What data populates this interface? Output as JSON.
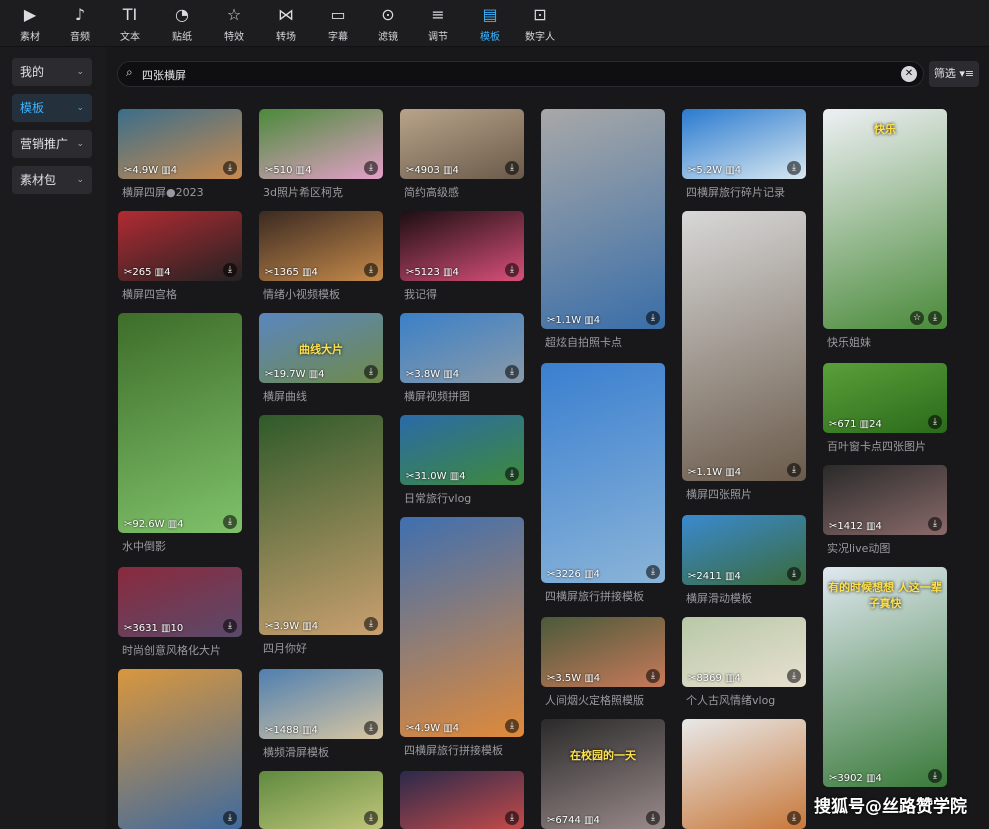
{
  "toolbar": {
    "items": [
      {
        "label": "素材",
        "icon": "media-icon"
      },
      {
        "label": "音频",
        "icon": "audio-icon"
      },
      {
        "label": "文本",
        "icon": "text-icon"
      },
      {
        "label": "贴纸",
        "icon": "sticker-icon"
      },
      {
        "label": "特效",
        "icon": "effects-icon"
      },
      {
        "label": "转场",
        "icon": "transition-icon"
      },
      {
        "label": "字幕",
        "icon": "subtitle-icon"
      },
      {
        "label": "滤镜",
        "icon": "filter-icon"
      },
      {
        "label": "调节",
        "icon": "adjust-icon"
      },
      {
        "label": "模板",
        "icon": "template-icon",
        "active": true
      },
      {
        "label": "数字人",
        "icon": "digital-human-icon"
      }
    ],
    "icons": [
      "▶",
      "♪",
      "TI",
      "◔",
      "☆",
      "⋈",
      "▭",
      "⊙",
      "≡",
      "▤",
      "⊡"
    ],
    "active_color": "#3ab4ff"
  },
  "sidebar": {
    "items": [
      {
        "label": "我的"
      },
      {
        "label": "模板",
        "active": true
      },
      {
        "label": "营销推广"
      },
      {
        "label": "素材包"
      }
    ]
  },
  "search": {
    "value": "四张横屏",
    "clear_icon": "close-icon"
  },
  "filter": {
    "label": "筛选 ▾≡"
  },
  "cards": {
    "c1": {
      "stats": "✂4.9W ▥4",
      "title": "横屏四屏●2023"
    },
    "c2": {
      "stats": "✂265 ▥4",
      "title": "横屏四宫格"
    },
    "c3": {
      "stats": "✂92.6W ▥4",
      "title": "水中倒影"
    },
    "c4": {
      "stats": "✂3631 ▥10",
      "title": "时尚创意风格化大片"
    },
    "c5": {
      "stats": "",
      "title": ""
    },
    "d1": {
      "stats": "✂510 ▥4",
      "title": "3d照片希区柯克"
    },
    "d2": {
      "stats": "✂1365 ▥4",
      "title": "情绪小视频模板"
    },
    "d3": {
      "stats": "✂19.7W ▥4",
      "title": "横屏曲线",
      "overlay": "曲线大片"
    },
    "d4": {
      "stats": "✂3.9W ▥4",
      "title": "四月你好"
    },
    "d5": {
      "stats": "✂1488 ▥4",
      "title": "横频滑屏模板"
    },
    "d6": {
      "stats": "",
      "title": ""
    },
    "e1": {
      "stats": "✂4903 ▥4",
      "title": "简约高级感"
    },
    "e2": {
      "stats": "✂5123 ▥4",
      "title": "我记得"
    },
    "e3": {
      "stats": "✂3.8W ▥4",
      "title": "横屏视频拼图"
    },
    "e4": {
      "stats": "✂31.0W ▥4",
      "title": "日常旅行vlog"
    },
    "e5": {
      "stats": "✂4.9W ▥4",
      "title": "四横屏旅行拼接模板"
    },
    "e6": {
      "stats": "",
      "title": ""
    },
    "f1": {
      "stats": "✂1.1W ▥4",
      "title": "超炫自拍照卡点"
    },
    "f2": {
      "stats": "✂3226 ▥4",
      "title": "四横屏旅行拼接模板"
    },
    "f3": {
      "stats": "✂3.5W ▥4",
      "title": "人间烟火定格照模版"
    },
    "f4": {
      "stats": "✂6744 ▥4",
      "title": "",
      "overlay": "在校园的一天"
    },
    "g1": {
      "stats": "✂5.2W ▥4",
      "title": "四横屏旅行碎片记录"
    },
    "g2": {
      "stats": "✂1.1W ▥4",
      "title": "横屏四张照片"
    },
    "g3": {
      "stats": "✂2411 ▥4",
      "title": "横屏滑动模板"
    },
    "g4": {
      "stats": "✂8369 ▥4",
      "title": "个人古风情绪vlog"
    },
    "g5": {
      "stats": "",
      "title": ""
    },
    "h1": {
      "stats": "",
      "title": "快乐姐妹",
      "overlay": "快乐"
    },
    "h2": {
      "stats": "✂671 ▥24",
      "title": "百叶窗卡点四张图片"
    },
    "h3": {
      "stats": "✂1412 ▥4",
      "title": "实况live动图"
    },
    "h4": {
      "stats": "✂3902 ▥4",
      "title": "",
      "overlay": "有的时候想想 人这一辈子真快"
    }
  },
  "watermark": "搜狐号@丝路赞学院"
}
